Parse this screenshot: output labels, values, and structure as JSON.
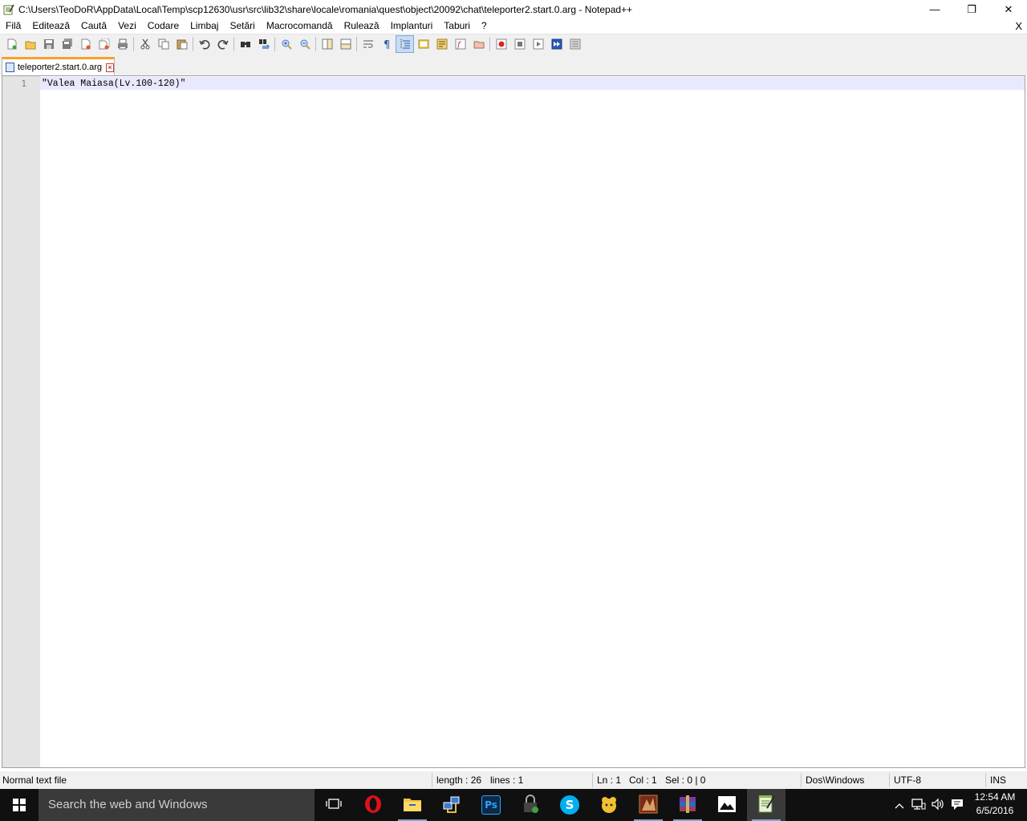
{
  "window": {
    "title": "C:\\Users\\TeoDoR\\AppData\\Local\\Temp\\scp12630\\usr\\src\\lib32\\share\\locale\\romania\\quest\\object\\20092\\chat\\teleporter2.start.0.arg - Notepad++",
    "minimize": "—",
    "restore": "❐",
    "close": "✕"
  },
  "menu": {
    "items": [
      "Filă",
      "Editează",
      "Caută",
      "Vezi",
      "Codare",
      "Limbaj",
      "Setări",
      "Macrocomandă",
      "Rulează",
      "Implanturi",
      "Taburi",
      "?"
    ],
    "close": "X"
  },
  "toolbar": {
    "icons": [
      "new-file-icon",
      "open-file-icon",
      "save-icon",
      "save-all-icon",
      "close-icon",
      "close-all-icon",
      "print-icon",
      "cut-icon",
      "copy-icon",
      "paste-icon",
      "undo-icon",
      "redo-icon",
      "find-icon",
      "replace-icon",
      "zoom-in-icon",
      "zoom-out-icon",
      "sync-vertical-icon",
      "sync-horizontal-icon",
      "word-wrap-icon",
      "show-all-chars-icon",
      "indent-guide-icon",
      "udl-icon",
      "doc-map-icon",
      "function-list-icon",
      "folder-workspace-icon",
      "record-macro-icon",
      "stop-macro-icon",
      "play-macro-icon",
      "run-macro-multiple-icon",
      "save-macro-icon"
    ]
  },
  "tab": {
    "label": "teleporter2.start.0.arg",
    "close": "×"
  },
  "editor": {
    "line_number": "1",
    "content": "\"Valea Maiasa(Lv.100-120)\""
  },
  "status": {
    "file_type": "Normal text file",
    "length": "length : 26",
    "lines": "lines : 1",
    "ln": "Ln : 1",
    "col": "Col : 1",
    "sel": "Sel : 0 | 0",
    "eol": "Dos\\Windows",
    "encoding": "UTF-8",
    "mode": "INS"
  },
  "taskbar": {
    "search_placeholder": "Search the web and Windows",
    "time": "12:54 AM",
    "date": "6/5/2016",
    "apps": [
      "task-view",
      "opera",
      "file-explorer",
      "network-app",
      "photoshop",
      "lock-app",
      "skype",
      "pac-app",
      "game-app",
      "winrar",
      "photos",
      "notepad-plus-plus"
    ]
  },
  "colors": {
    "tab_accent": "#fa9f2c",
    "gutter": "#e4e4e4",
    "current_line": "#e8e8ff",
    "taskbar": "#101010"
  }
}
